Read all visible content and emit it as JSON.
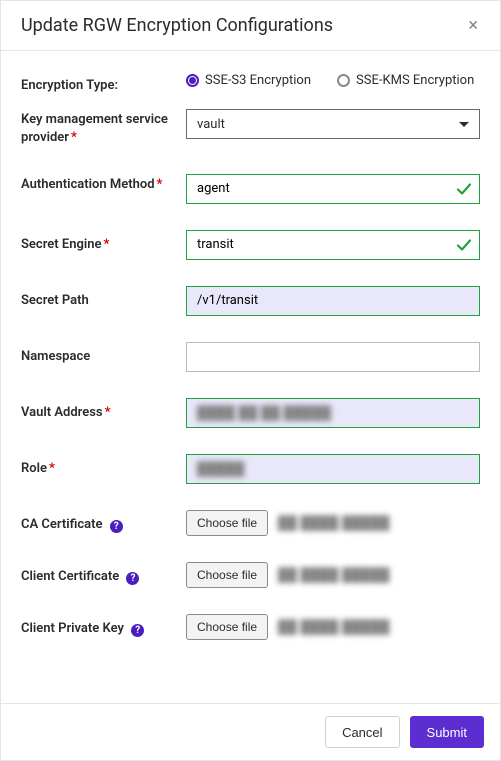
{
  "header": {
    "title": "Update RGW Encryption Configurations",
    "close_tooltip": "Close"
  },
  "form": {
    "encryption_type": {
      "label": "Encryption Type:",
      "options": {
        "s3": "SSE-S3 Encryption",
        "kms": "SSE-KMS Encryption"
      },
      "selected": "s3"
    },
    "kms_provider": {
      "label": "Key management service provider",
      "required": true,
      "value": "vault"
    },
    "auth_method": {
      "label": "Authentication Method",
      "required": true,
      "value": "agent",
      "valid": true
    },
    "secret_engine": {
      "label": "Secret Engine",
      "required": true,
      "value": "transit",
      "valid": true
    },
    "secret_path": {
      "label": "Secret Path",
      "required": false,
      "value": "/v1/transit"
    },
    "namespace": {
      "label": "Namespace",
      "required": false,
      "value": ""
    },
    "vault_address": {
      "label": "Vault Address",
      "required": true,
      "value_display": "████ ██ ██ █████"
    },
    "role": {
      "label": "Role",
      "required": true,
      "value_display": "█████"
    },
    "file_choose_label": "Choose file",
    "file_obscured_name": "██ ████ █████",
    "ca_cert": {
      "label": "CA Certificate"
    },
    "client_cert": {
      "label": "Client Certificate"
    },
    "client_key": {
      "label": "Client Private Key"
    }
  },
  "footer": {
    "cancel": "Cancel",
    "submit": "Submit"
  }
}
